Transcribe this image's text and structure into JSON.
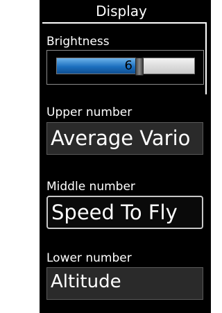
{
  "header": {
    "title": "Display"
  },
  "brightness": {
    "label": "Brightness",
    "value": "6",
    "level": 0.6
  },
  "upper": {
    "label": "Upper number",
    "value": "Average Vario"
  },
  "middle": {
    "label": "Middle number",
    "value": "Speed To Fly"
  },
  "lower": {
    "label": "Lower number",
    "value": "Altitude"
  }
}
